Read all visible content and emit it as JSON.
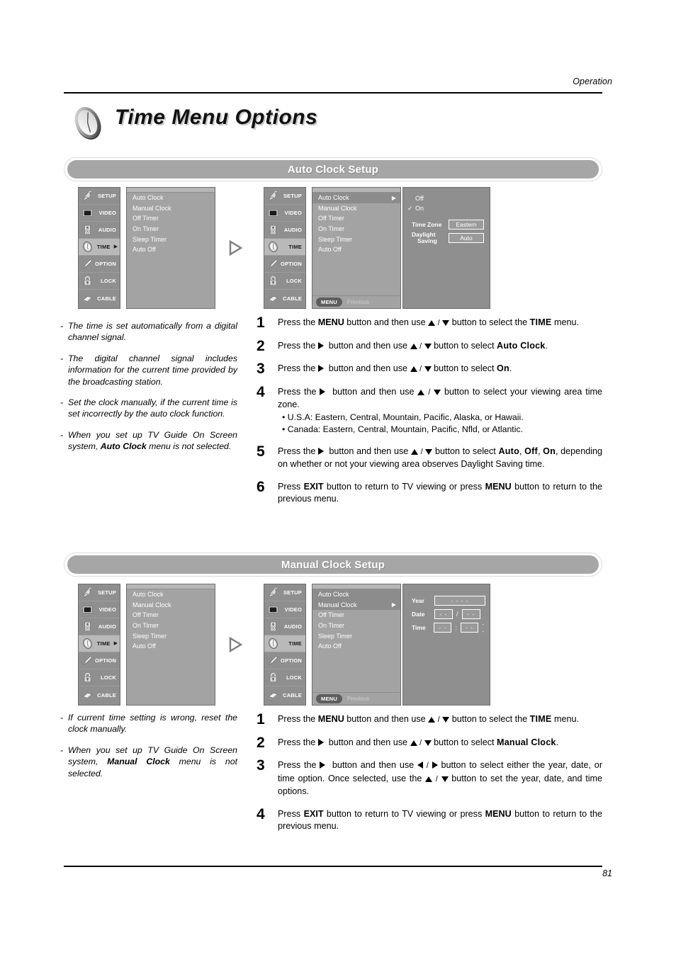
{
  "header": {
    "section_label": "Operation",
    "page_number": "81"
  },
  "title": {
    "text": "Time Menu Options",
    "icon": "clock-icon"
  },
  "sections": [
    {
      "id": "auto-clock",
      "heading": "Auto Clock Setup",
      "osd_before": {
        "sidebar": [
          {
            "label": "SETUP",
            "icon": "satellite-dish-icon",
            "active": false,
            "arrow": ""
          },
          {
            "label": "VIDEO",
            "icon": "screen-icon",
            "active": false,
            "arrow": ""
          },
          {
            "label": "AUDIO",
            "icon": "speaker-icon",
            "active": false,
            "arrow": ""
          },
          {
            "label": "TIME",
            "icon": "clock-icon",
            "active": true,
            "arrow": "▶"
          },
          {
            "label": "OPTION",
            "icon": "brush-icon",
            "active": false,
            "arrow": ""
          },
          {
            "label": "LOCK",
            "icon": "padlock-icon",
            "active": false,
            "arrow": ""
          },
          {
            "label": "CABLE",
            "icon": "cable-icon",
            "active": false,
            "arrow": ""
          }
        ],
        "items": [
          {
            "label": "Auto Clock",
            "selected": false,
            "arrow": ""
          },
          {
            "label": "Manual Clock",
            "selected": false,
            "arrow": ""
          },
          {
            "label": "Off Timer",
            "selected": false,
            "arrow": ""
          },
          {
            "label": "On Timer",
            "selected": false,
            "arrow": ""
          },
          {
            "label": "Sleep Timer",
            "selected": false,
            "arrow": ""
          },
          {
            "label": "Auto Off",
            "selected": false,
            "arrow": ""
          }
        ]
      },
      "osd_after": {
        "sidebar": [
          {
            "label": "SETUP",
            "icon": "satellite-dish-icon",
            "active": false,
            "arrow": ""
          },
          {
            "label": "VIDEO",
            "icon": "screen-icon",
            "active": false,
            "arrow": ""
          },
          {
            "label": "AUDIO",
            "icon": "speaker-icon",
            "active": false,
            "arrow": ""
          },
          {
            "label": "TIME",
            "icon": "clock-icon",
            "active": true,
            "arrow": ""
          },
          {
            "label": "OPTION",
            "icon": "brush-icon",
            "active": false,
            "arrow": ""
          },
          {
            "label": "LOCK",
            "icon": "padlock-icon",
            "active": false,
            "arrow": ""
          },
          {
            "label": "CABLE",
            "icon": "cable-icon",
            "active": false,
            "arrow": ""
          }
        ],
        "items": [
          {
            "label": "Auto Clock",
            "selected": true,
            "arrow": "▶"
          },
          {
            "label": "Manual Clock",
            "selected": false,
            "arrow": ""
          },
          {
            "label": "Off Timer",
            "selected": false,
            "arrow": ""
          },
          {
            "label": "On Timer",
            "selected": false,
            "arrow": ""
          },
          {
            "label": "Sleep Timer",
            "selected": false,
            "arrow": ""
          },
          {
            "label": "Auto Off",
            "selected": false,
            "arrow": ""
          }
        ],
        "footer": {
          "menu_label": "MENU",
          "previous_label": "Previous"
        },
        "options": [
          {
            "label": "Off",
            "checked": false
          },
          {
            "label": "On",
            "checked": true
          }
        ],
        "fields": [
          {
            "label": "Time Zone",
            "value": "Eastern"
          },
          {
            "label_line1": "Daylight",
            "label_line2": "Saving",
            "value": "Auto"
          }
        ]
      },
      "notes": [
        "The time is set automatically from a digital channel signal.",
        "The digital channel signal includes information for the current time provided by the broadcasting station.",
        "Set the clock manually, if the current time is set incorrectly by the auto clock function.",
        "When you set up TV  Guide On Screen system, |Auto Clock| menu is not selected."
      ],
      "steps": [
        {
          "num": "1",
          "html": "Press the <b>MENU</b> button and then use <TRI_UP> <span class=\"sep\">/</span> <TRI_DN> button to select the <span class=\"slab\">TIME</span> menu."
        },
        {
          "num": "2",
          "html": "Press the <TRI_RT> &nbsp;button and then use <TRI_UP> <span class=\"sep\">/</span> <TRI_DN> button to select <span class=\"slab\">Auto Clock</span>."
        },
        {
          "num": "3",
          "html": "Press the <TRI_RT> &nbsp;button and then use <TRI_UP> <span class=\"sep\">/</span> <TRI_DN> button to select <span class=\"slab\">On</span>."
        },
        {
          "num": "4",
          "html": "Press the <TRI_RT> &nbsp;button and then use <TRI_UP> <span class=\"sep\">/</span> <TRI_DN> button to select your viewing area time zone.",
          "sub": [
            "• U.S.A: <span class=\"slab\">Eastern</span>, <span class=\"slab\">Central</span>, <span class=\"slab\">Mountain</span>, <span class=\"slab\">Pacific</span>, <span class=\"slab\">Alaska</span>, or <span class=\"slab\">Hawaii</span>.",
            "• Canada: <span class=\"slab\">Eastern</span>, <span class=\"slab\">Central</span>, <span class=\"slab\">Mountain</span>, <span class=\"slab\">Pacific</span>, <span class=\"slab\">Nfld</span>, or <span class=\"slab\">Atlantic</span>."
          ]
        },
        {
          "num": "5",
          "html": "Press the <TRI_RT> &nbsp;button and then use <TRI_UP> <span class=\"sep\">/</span> <TRI_DN> button to select <span class=\"slab\">Auto</span>, <span class=\"slab\">Off</span>, <span class=\"slab\">On</span>, depending on whether or not your viewing area observes Daylight Saving time."
        },
        {
          "num": "6",
          "html": "Press <b>EXIT</b> button to return to TV viewing or press <b>MENU</b> button to return to the previous menu."
        }
      ]
    },
    {
      "id": "manual-clock",
      "heading": "Manual Clock Setup",
      "osd_before": {
        "sidebar": [
          {
            "label": "SETUP",
            "icon": "satellite-dish-icon",
            "active": false,
            "arrow": ""
          },
          {
            "label": "VIDEO",
            "icon": "screen-icon",
            "active": false,
            "arrow": ""
          },
          {
            "label": "AUDIO",
            "icon": "speaker-icon",
            "active": false,
            "arrow": ""
          },
          {
            "label": "TIME",
            "icon": "clock-icon",
            "active": true,
            "arrow": "▶"
          },
          {
            "label": "OPTION",
            "icon": "brush-icon",
            "active": false,
            "arrow": ""
          },
          {
            "label": "LOCK",
            "icon": "padlock-icon",
            "active": false,
            "arrow": ""
          },
          {
            "label": "CABLE",
            "icon": "cable-icon",
            "active": false,
            "arrow": ""
          }
        ],
        "items": [
          {
            "label": "Auto Clock",
            "selected": false,
            "arrow": ""
          },
          {
            "label": "Manual Clock",
            "selected": false,
            "arrow": ""
          },
          {
            "label": "Off Timer",
            "selected": false,
            "arrow": ""
          },
          {
            "label": "On Timer",
            "selected": false,
            "arrow": ""
          },
          {
            "label": "Sleep Timer",
            "selected": false,
            "arrow": ""
          },
          {
            "label": "Auto Off",
            "selected": false,
            "arrow": ""
          }
        ]
      },
      "osd_after": {
        "sidebar": [
          {
            "label": "SETUP",
            "icon": "satellite-dish-icon",
            "active": false,
            "arrow": ""
          },
          {
            "label": "VIDEO",
            "icon": "screen-icon",
            "active": false,
            "arrow": ""
          },
          {
            "label": "AUDIO",
            "icon": "speaker-icon",
            "active": false,
            "arrow": ""
          },
          {
            "label": "TIME",
            "icon": "clock-icon",
            "active": true,
            "arrow": ""
          },
          {
            "label": "OPTION",
            "icon": "brush-icon",
            "active": false,
            "arrow": ""
          },
          {
            "label": "LOCK",
            "icon": "padlock-icon",
            "active": false,
            "arrow": ""
          },
          {
            "label": "CABLE",
            "icon": "cable-icon",
            "active": false,
            "arrow": ""
          }
        ],
        "items": [
          {
            "label": "Auto Clock",
            "selected": true,
            "arrow": ""
          },
          {
            "label": "Manual Clock",
            "selected": true,
            "arrow": "▶"
          },
          {
            "label": "Off Timer",
            "selected": false,
            "arrow": ""
          },
          {
            "label": "On Timer",
            "selected": false,
            "arrow": ""
          },
          {
            "label": "Sleep Timer",
            "selected": false,
            "arrow": ""
          },
          {
            "label": "Auto Off",
            "selected": false,
            "arrow": ""
          }
        ],
        "footer": {
          "menu_label": "MENU",
          "previous_label": "Previous"
        },
        "clock_fields": [
          {
            "label": "Year",
            "values": [
              "- - - -"
            ],
            "sep": "",
            "tail": ""
          },
          {
            "label": "Date",
            "values": [
              "- -",
              "- -"
            ],
            "sep": "/",
            "tail": ""
          },
          {
            "label": "Time",
            "values": [
              "- -",
              "- -"
            ],
            "sep": ":",
            "tail": "- -"
          }
        ]
      },
      "notes": [
        "If current time setting is wrong, reset the clock manually.",
        "When you set up TV  Guide On Screen system, |Manual Clock| menu is not selected."
      ],
      "steps": [
        {
          "num": "1",
          "html": "Press the <b>MENU</b> button and then use <TRI_UP> <span class=\"sep\">/</span> <TRI_DN> button to select the <span class=\"slab\">TIME</span> menu."
        },
        {
          "num": "2",
          "html": "Press the <TRI_RT> &nbsp;button and then use <TRI_UP> <span class=\"sep\">/</span> <TRI_DN> button to select <span class=\"slab\">Manual Clock</span>."
        },
        {
          "num": "3",
          "html": "Press the <TRI_RT> &nbsp;button and then use <TRI_LF> <span class=\"sep\">/</span> <TRI_RT> button to select either the year, date, or time option. Once selected, use the <TRI_UP> <span class=\"sep\">/</span> <TRI_DN> button to set the year, date, and time options."
        },
        {
          "num": "4",
          "html": "Press <b>EXIT</b> button to return to TV viewing or press <b>MENU</b> button to return to the previous menu."
        }
      ]
    }
  ],
  "colors": {
    "osd_sidebar": "#8f8f8f",
    "osd_list": "#a3a3a3",
    "osd_selected": "#8c8c8c",
    "section_bar": "#a6a6a6",
    "text_white": "#ffffff"
  }
}
